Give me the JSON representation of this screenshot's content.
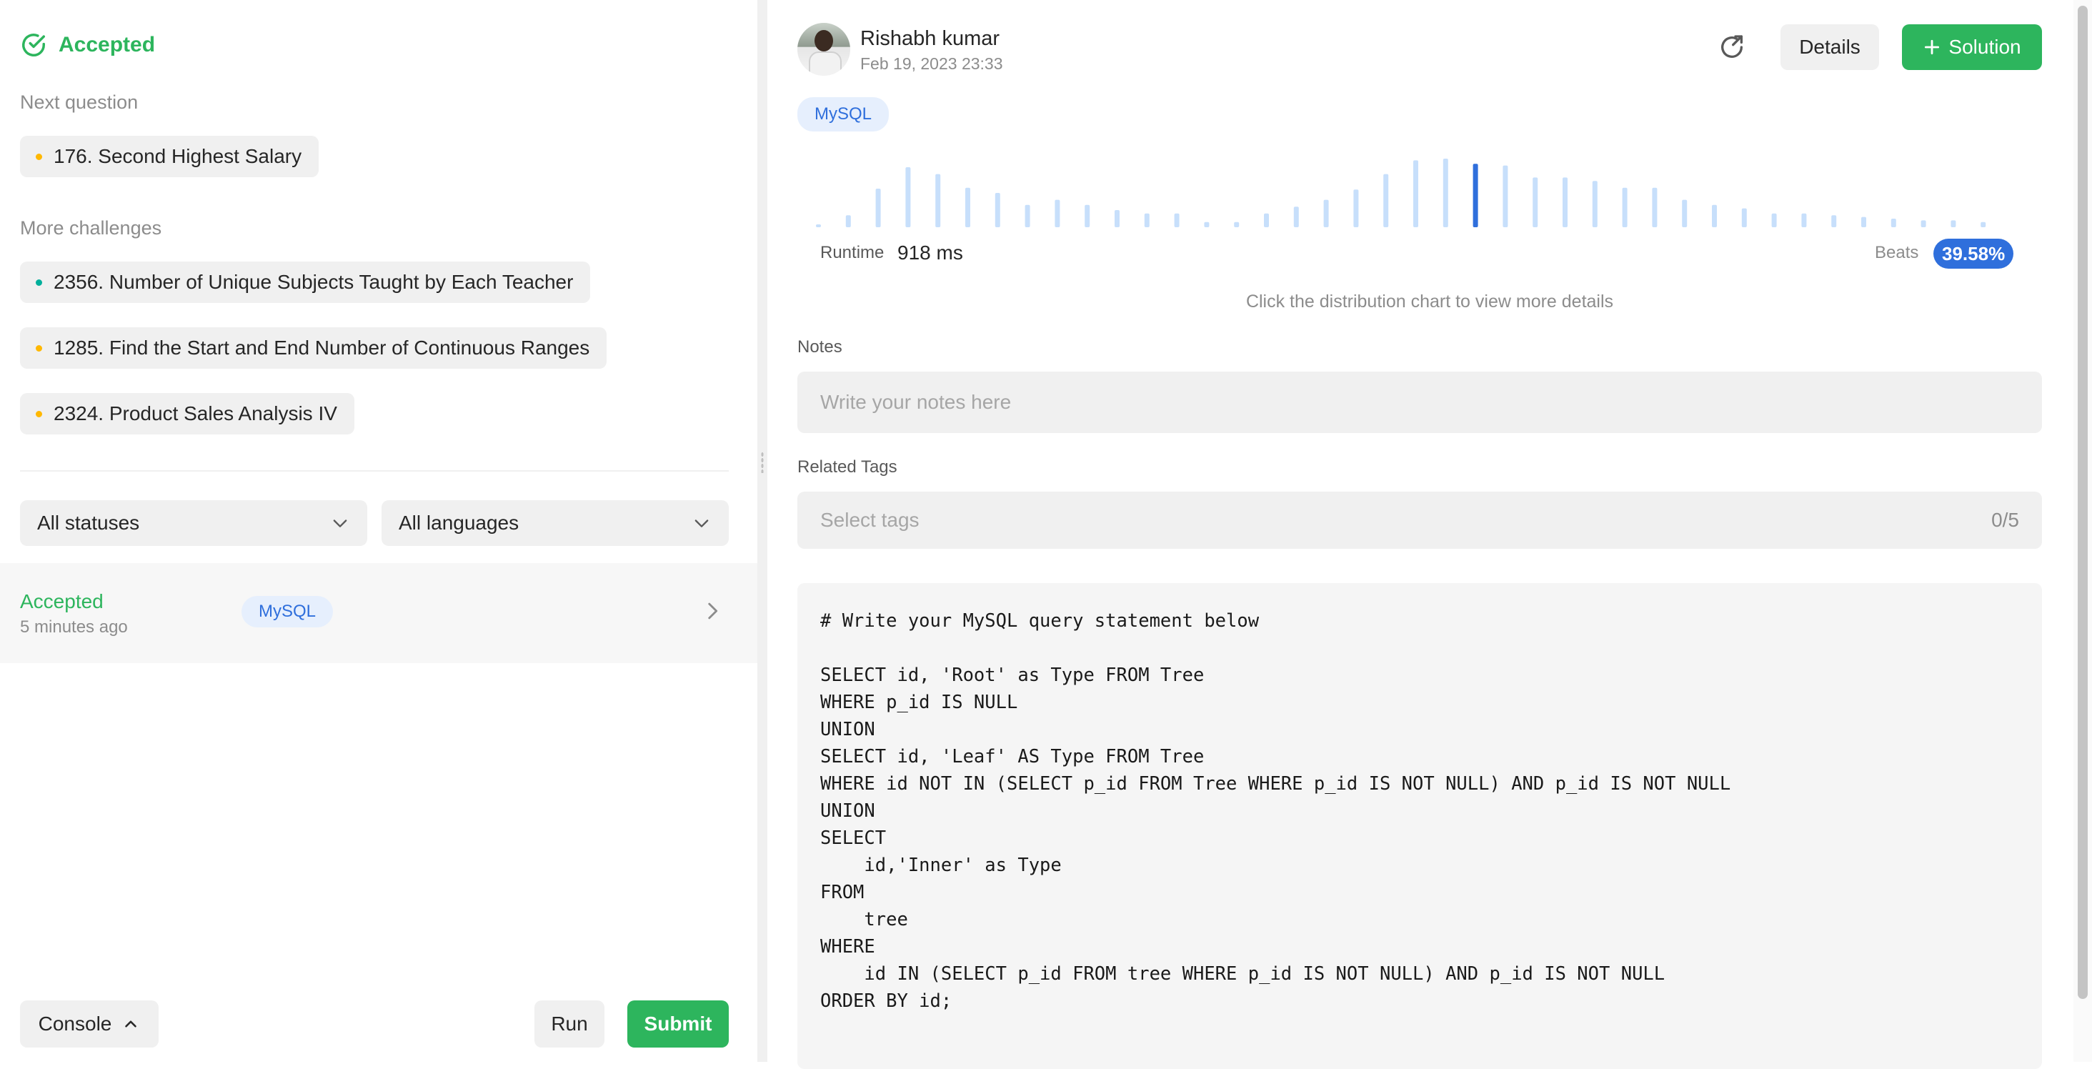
{
  "left": {
    "status": "Accepted",
    "next_question_label": "Next question",
    "next_question": {
      "title": "176. Second Highest Salary",
      "difficulty_color": "#ffb800"
    },
    "more_challenges_label": "More challenges",
    "more_challenges": [
      {
        "title": "2356. Number of Unique Subjects Taught by Each Teacher",
        "difficulty_color": "#00af9b"
      },
      {
        "title": "1285. Find the Start and End Number of Continuous Ranges",
        "difficulty_color": "#ffb800"
      },
      {
        "title": "2324. Product Sales Analysis IV",
        "difficulty_color": "#ffb800"
      }
    ],
    "filters": {
      "status": "All statuses",
      "language": "All languages"
    },
    "submission": {
      "status": "Accepted",
      "time": "5 minutes ago",
      "language": "MySQL"
    },
    "footer": {
      "console": "Console",
      "run": "Run",
      "submit": "Submit"
    }
  },
  "right": {
    "user": {
      "name": "Rishabh kumar",
      "date": "Feb 19, 2023 23:33"
    },
    "details_label": "Details",
    "solution_label": "Solution",
    "language": "MySQL",
    "runtime_label": "Runtime",
    "runtime_value": "918 ms",
    "beats_label": "Beats",
    "beats_value": "39.58%",
    "chart_hint": "Click the distribution chart to view more details",
    "notes_label": "Notes",
    "notes_placeholder": "Write your notes here",
    "tags_label": "Related Tags",
    "tags_placeholder": "Select tags",
    "tags_count": "0/5",
    "code": [
      "# Write your MySQL query statement below",
      "",
      "SELECT id, 'Root' as Type FROM Tree",
      "WHERE p_id IS NULL",
      "UNION",
      "SELECT id, 'Leaf' AS Type FROM Tree",
      "WHERE id NOT IN (SELECT p_id FROM Tree WHERE p_id IS NOT NULL) AND p_id IS NOT NULL",
      "UNION",
      "SELECT",
      "    id,'Inner' as Type",
      "FROM",
      "    tree",
      "WHERE",
      "    id IN (SELECT p_id FROM tree WHERE p_id IS NOT NULL) AND p_id IS NOT NULL",
      "ORDER BY id;"
    ]
  },
  "chart_data": {
    "type": "bar",
    "values": [
      3,
      14,
      45,
      70,
      62,
      46,
      40,
      26,
      32,
      26,
      20,
      16,
      16,
      6,
      6,
      16,
      24,
      32,
      44,
      62,
      78,
      80,
      74,
      72,
      58,
      58,
      54,
      46,
      46,
      32,
      26,
      22,
      16,
      16,
      14,
      12,
      10,
      8,
      8,
      6
    ],
    "highlight_index": 22,
    "colors": {
      "bar": "#c7dffb",
      "highlight": "#2f6fdc"
    }
  }
}
